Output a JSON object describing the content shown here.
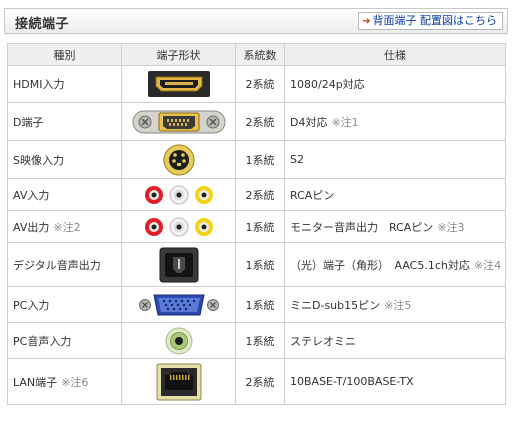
{
  "header": {
    "title": "接続端子",
    "link_label": "背面端子 配置図はこちら"
  },
  "table": {
    "columns": [
      "種別",
      "端子形状",
      "系統数",
      "仕様"
    ],
    "rows": [
      {
        "type": "HDMI入力",
        "type_note": "",
        "icon": "hdmi-port-icon",
        "count": "2系統",
        "spec": "1080/24p対応",
        "spec_note": ""
      },
      {
        "type": "D端子",
        "type_note": "",
        "icon": "d-terminal-port-icon",
        "count": "2系統",
        "spec": "D4対応",
        "spec_note": "※注1"
      },
      {
        "type": "S映像入力",
        "type_note": "",
        "icon": "s-video-port-icon",
        "count": "1系統",
        "spec": "S2",
        "spec_note": ""
      },
      {
        "type": "AV入力",
        "type_note": "",
        "icon": "rca-jacks-icon",
        "count": "2系統",
        "spec": "RCAピン",
        "spec_note": ""
      },
      {
        "type": "AV出力",
        "type_note": "※注2",
        "icon": "rca-jacks-icon",
        "count": "1系統",
        "spec": "モニター音声出力　RCAピン",
        "spec_note": "※注3"
      },
      {
        "type": "デジタル音声出力",
        "type_note": "",
        "icon": "optical-port-icon",
        "count": "1系統",
        "spec": "（光）端子（角形）　AAC5.1ch対応",
        "spec_note": "※注4"
      },
      {
        "type": "PC入力",
        "type_note": "",
        "icon": "vga-port-icon",
        "count": "1系統",
        "spec": "ミニD-sub15ピン",
        "spec_note": "※注5"
      },
      {
        "type": "PC音声入力",
        "type_note": "",
        "icon": "mini-jack-icon",
        "count": "1系統",
        "spec": "ステレオミニ",
        "spec_note": ""
      },
      {
        "type": "LAN端子",
        "type_note": "※注6",
        "icon": "lan-port-icon",
        "count": "2系統",
        "spec": "10BASE-T/100BASE-TX",
        "spec_note": ""
      }
    ]
  }
}
